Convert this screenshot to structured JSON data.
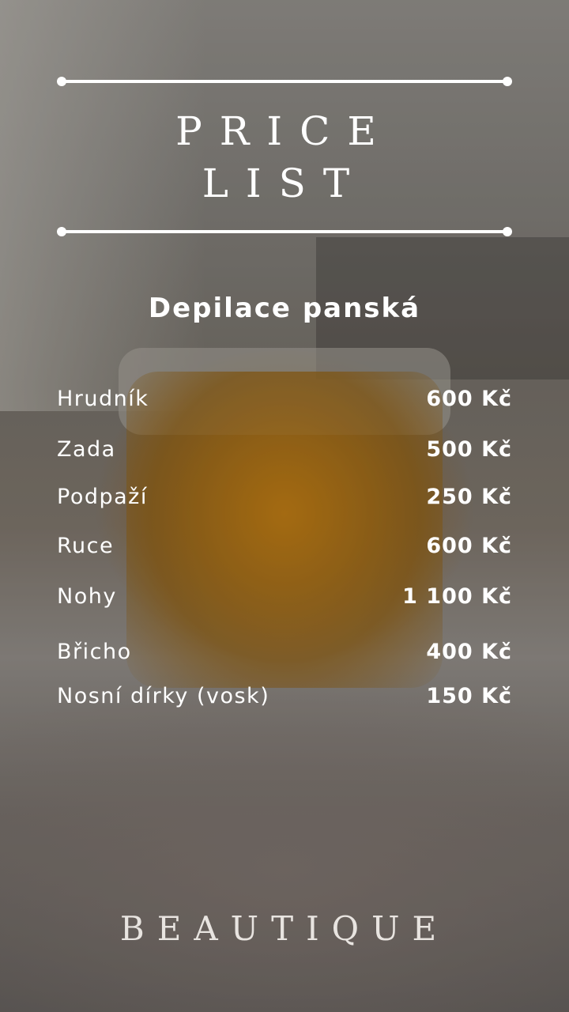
{
  "title": {
    "line1": "PRICE",
    "line2": "LIST"
  },
  "section": {
    "title": "Depilace panská"
  },
  "items": [
    {
      "name": "Hrudník",
      "price": "600 Kč"
    },
    {
      "name": "Zada",
      "price": "500 Kč"
    },
    {
      "name": "Podpaží",
      "price": "250 Kč"
    },
    {
      "name": "Ruce",
      "price": "600 Kč"
    },
    {
      "name": "Nohy",
      "price": "1 100 Kč"
    },
    {
      "name": "Břicho",
      "price": "400 Kč"
    },
    {
      "name": "Nosní dírky (vosk)",
      "price": "150 Kč"
    }
  ],
  "brand": {
    "name": "BEAUTIQUE"
  },
  "colors": {
    "text": "#ffffff",
    "brand": "#e8e4e0",
    "jar_accent": "#a86a0c"
  }
}
